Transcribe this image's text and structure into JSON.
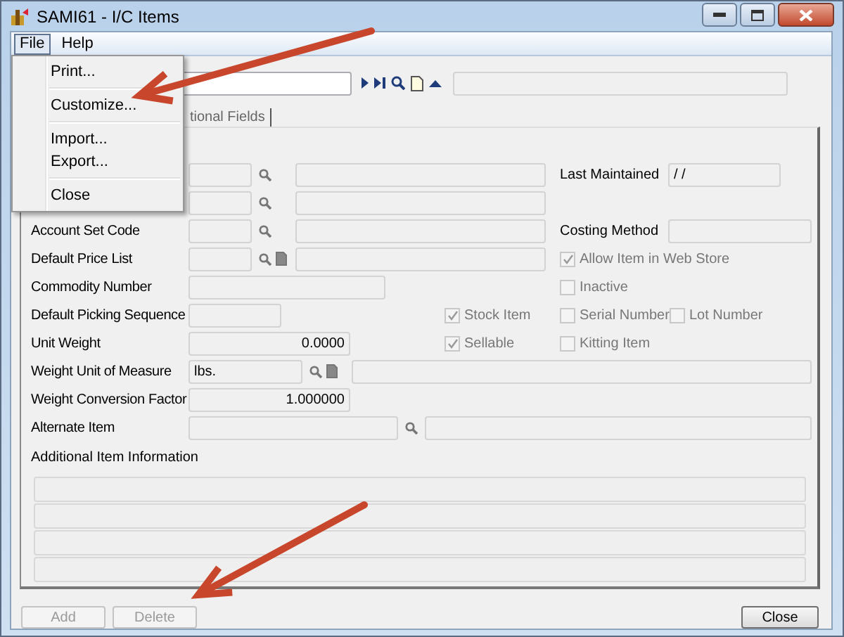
{
  "window": {
    "title": "SAMI61 - I/C Items"
  },
  "menubar": [
    {
      "label": "File",
      "selected": true
    },
    {
      "label": "Help",
      "selected": false
    }
  ],
  "file_menu": [
    {
      "kind": "item",
      "label": "Print..."
    },
    {
      "kind": "separator"
    },
    {
      "kind": "item",
      "label": "Customize..."
    },
    {
      "kind": "separator"
    },
    {
      "kind": "item",
      "label": "Import..."
    },
    {
      "kind": "item",
      "label": "Export..."
    },
    {
      "kind": "separator"
    },
    {
      "kind": "item",
      "label": "Close"
    }
  ],
  "tabs": [
    {
      "label": "tional Fields",
      "selected": false
    }
  ],
  "form_rows": [
    {
      "left": {
        "kind": "lookup"
      },
      "right": [
        {
          "kind": "date",
          "label": "Last Maintained",
          "value": "/ /"
        }
      ]
    },
    {
      "left": {
        "kind": "lookup"
      }
    },
    {
      "label": "Account Set Code",
      "left": {
        "kind": "lookup"
      },
      "right": [
        {
          "kind": "field",
          "label": "Costing Method"
        }
      ]
    },
    {
      "label": "Default Price List",
      "left": {
        "kind": "lookup",
        "new_button": true
      },
      "right": [
        {
          "kind": "checkbox",
          "label": "Allow Item in Web Store",
          "checked": true,
          "disabled": true
        }
      ]
    },
    {
      "label": "Commodity Number",
      "left": {
        "kind": "text"
      },
      "right": [
        {
          "kind": "checkbox",
          "label": "Inactive",
          "checked": false,
          "disabled": true
        }
      ]
    },
    {
      "label": "Default Picking Sequence",
      "left": {
        "kind": "short"
      },
      "middle": {
        "kind": "checkbox",
        "label": "Stock Item",
        "checked": true,
        "disabled": true
      },
      "right": [
        {
          "kind": "checkbox",
          "label": "Serial Number",
          "checked": false,
          "disabled": true
        },
        {
          "kind": "checkbox",
          "label": "Lot Number",
          "checked": false,
          "disabled": true
        }
      ]
    },
    {
      "label": "Unit Weight",
      "left": {
        "kind": "number",
        "value": "0.0000"
      },
      "middle": {
        "kind": "checkbox",
        "label": "Sellable",
        "checked": true,
        "disabled": true
      },
      "right": [
        {
          "kind": "checkbox",
          "label": "Kitting Item",
          "checked": false,
          "disabled": true
        }
      ]
    },
    {
      "label": "Weight Unit of Measure",
      "left": {
        "kind": "unit",
        "value": "lbs.",
        "new_button": true
      }
    },
    {
      "label": "Weight Conversion Factor",
      "left": {
        "kind": "number",
        "value": "1.000000"
      }
    },
    {
      "label": "Alternate Item",
      "left": {
        "kind": "alternate"
      }
    }
  ],
  "additional_info": {
    "label": "Additional Item Information"
  },
  "buttons": [
    {
      "label": "Add",
      "disabled": true
    },
    {
      "label": "Delete",
      "disabled": true
    },
    {
      "label": "Close",
      "disabled": false
    }
  ]
}
